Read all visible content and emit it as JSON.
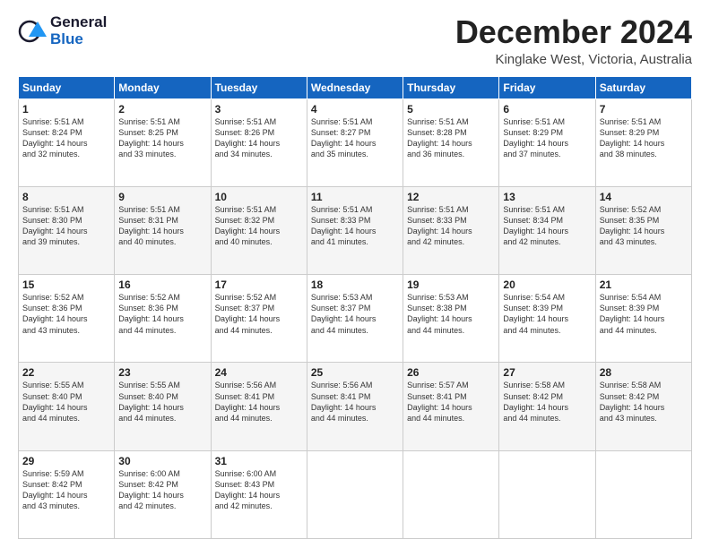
{
  "logo": {
    "line1": "General",
    "line2": "Blue"
  },
  "header": {
    "month": "December 2024",
    "location": "Kinglake West, Victoria, Australia"
  },
  "weekdays": [
    "Sunday",
    "Monday",
    "Tuesday",
    "Wednesday",
    "Thursday",
    "Friday",
    "Saturday"
  ],
  "weeks": [
    [
      {
        "day": "1",
        "sunrise": "5:51 AM",
        "sunset": "8:24 PM",
        "daylight": "14 hours and 32 minutes."
      },
      {
        "day": "2",
        "sunrise": "5:51 AM",
        "sunset": "8:25 PM",
        "daylight": "14 hours and 33 minutes."
      },
      {
        "day": "3",
        "sunrise": "5:51 AM",
        "sunset": "8:26 PM",
        "daylight": "14 hours and 34 minutes."
      },
      {
        "day": "4",
        "sunrise": "5:51 AM",
        "sunset": "8:27 PM",
        "daylight": "14 hours and 35 minutes."
      },
      {
        "day": "5",
        "sunrise": "5:51 AM",
        "sunset": "8:28 PM",
        "daylight": "14 hours and 36 minutes."
      },
      {
        "day": "6",
        "sunrise": "5:51 AM",
        "sunset": "8:29 PM",
        "daylight": "14 hours and 37 minutes."
      },
      {
        "day": "7",
        "sunrise": "5:51 AM",
        "sunset": "8:29 PM",
        "daylight": "14 hours and 38 minutes."
      }
    ],
    [
      {
        "day": "8",
        "sunrise": "5:51 AM",
        "sunset": "8:30 PM",
        "daylight": "14 hours and 39 minutes."
      },
      {
        "day": "9",
        "sunrise": "5:51 AM",
        "sunset": "8:31 PM",
        "daylight": "14 hours and 40 minutes."
      },
      {
        "day": "10",
        "sunrise": "5:51 AM",
        "sunset": "8:32 PM",
        "daylight": "14 hours and 40 minutes."
      },
      {
        "day": "11",
        "sunrise": "5:51 AM",
        "sunset": "8:33 PM",
        "daylight": "14 hours and 41 minutes."
      },
      {
        "day": "12",
        "sunrise": "5:51 AM",
        "sunset": "8:33 PM",
        "daylight": "14 hours and 42 minutes."
      },
      {
        "day": "13",
        "sunrise": "5:51 AM",
        "sunset": "8:34 PM",
        "daylight": "14 hours and 42 minutes."
      },
      {
        "day": "14",
        "sunrise": "5:52 AM",
        "sunset": "8:35 PM",
        "daylight": "14 hours and 43 minutes."
      }
    ],
    [
      {
        "day": "15",
        "sunrise": "5:52 AM",
        "sunset": "8:36 PM",
        "daylight": "14 hours and 43 minutes."
      },
      {
        "day": "16",
        "sunrise": "5:52 AM",
        "sunset": "8:36 PM",
        "daylight": "14 hours and 44 minutes."
      },
      {
        "day": "17",
        "sunrise": "5:52 AM",
        "sunset": "8:37 PM",
        "daylight": "14 hours and 44 minutes."
      },
      {
        "day": "18",
        "sunrise": "5:53 AM",
        "sunset": "8:37 PM",
        "daylight": "14 hours and 44 minutes."
      },
      {
        "day": "19",
        "sunrise": "5:53 AM",
        "sunset": "8:38 PM",
        "daylight": "14 hours and 44 minutes."
      },
      {
        "day": "20",
        "sunrise": "5:54 AM",
        "sunset": "8:39 PM",
        "daylight": "14 hours and 44 minutes."
      },
      {
        "day": "21",
        "sunrise": "5:54 AM",
        "sunset": "8:39 PM",
        "daylight": "14 hours and 44 minutes."
      }
    ],
    [
      {
        "day": "22",
        "sunrise": "5:55 AM",
        "sunset": "8:40 PM",
        "daylight": "14 hours and 44 minutes."
      },
      {
        "day": "23",
        "sunrise": "5:55 AM",
        "sunset": "8:40 PM",
        "daylight": "14 hours and 44 minutes."
      },
      {
        "day": "24",
        "sunrise": "5:56 AM",
        "sunset": "8:41 PM",
        "daylight": "14 hours and 44 minutes."
      },
      {
        "day": "25",
        "sunrise": "5:56 AM",
        "sunset": "8:41 PM",
        "daylight": "14 hours and 44 minutes."
      },
      {
        "day": "26",
        "sunrise": "5:57 AM",
        "sunset": "8:41 PM",
        "daylight": "14 hours and 44 minutes."
      },
      {
        "day": "27",
        "sunrise": "5:58 AM",
        "sunset": "8:42 PM",
        "daylight": "14 hours and 44 minutes."
      },
      {
        "day": "28",
        "sunrise": "5:58 AM",
        "sunset": "8:42 PM",
        "daylight": "14 hours and 43 minutes."
      }
    ],
    [
      {
        "day": "29",
        "sunrise": "5:59 AM",
        "sunset": "8:42 PM",
        "daylight": "14 hours and 43 minutes."
      },
      {
        "day": "30",
        "sunrise": "6:00 AM",
        "sunset": "8:42 PM",
        "daylight": "14 hours and 42 minutes."
      },
      {
        "day": "31",
        "sunrise": "6:00 AM",
        "sunset": "8:43 PM",
        "daylight": "14 hours and 42 minutes."
      },
      null,
      null,
      null,
      null
    ]
  ]
}
